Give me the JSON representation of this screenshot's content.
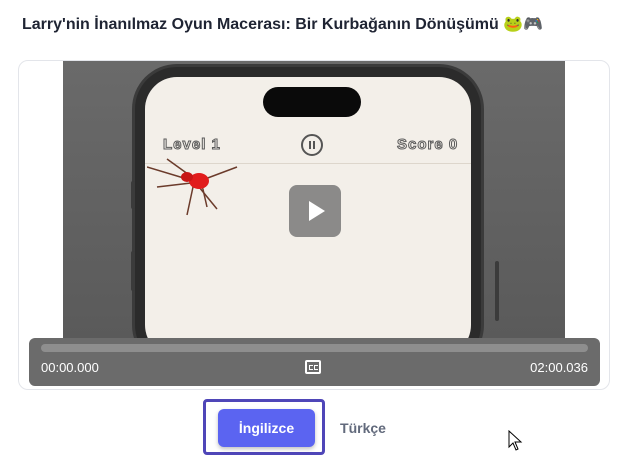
{
  "header": {
    "title": "Larry'nin İnanılmaz Oyun Macerası: Bir Kurbağanın Dönüşümü 🐸🎮"
  },
  "video": {
    "game_level": "Level 1",
    "game_score": "Score 0",
    "current_time": "00:00.000",
    "total_time": "02:00.036",
    "progress": 0
  },
  "language": {
    "english_label": "İngilizce",
    "turkish_label": "Türkçe",
    "selected": "english"
  },
  "colors": {
    "accent": "#5b64f1",
    "focus_ring": "#4f46b8",
    "title": "#1f2433"
  }
}
